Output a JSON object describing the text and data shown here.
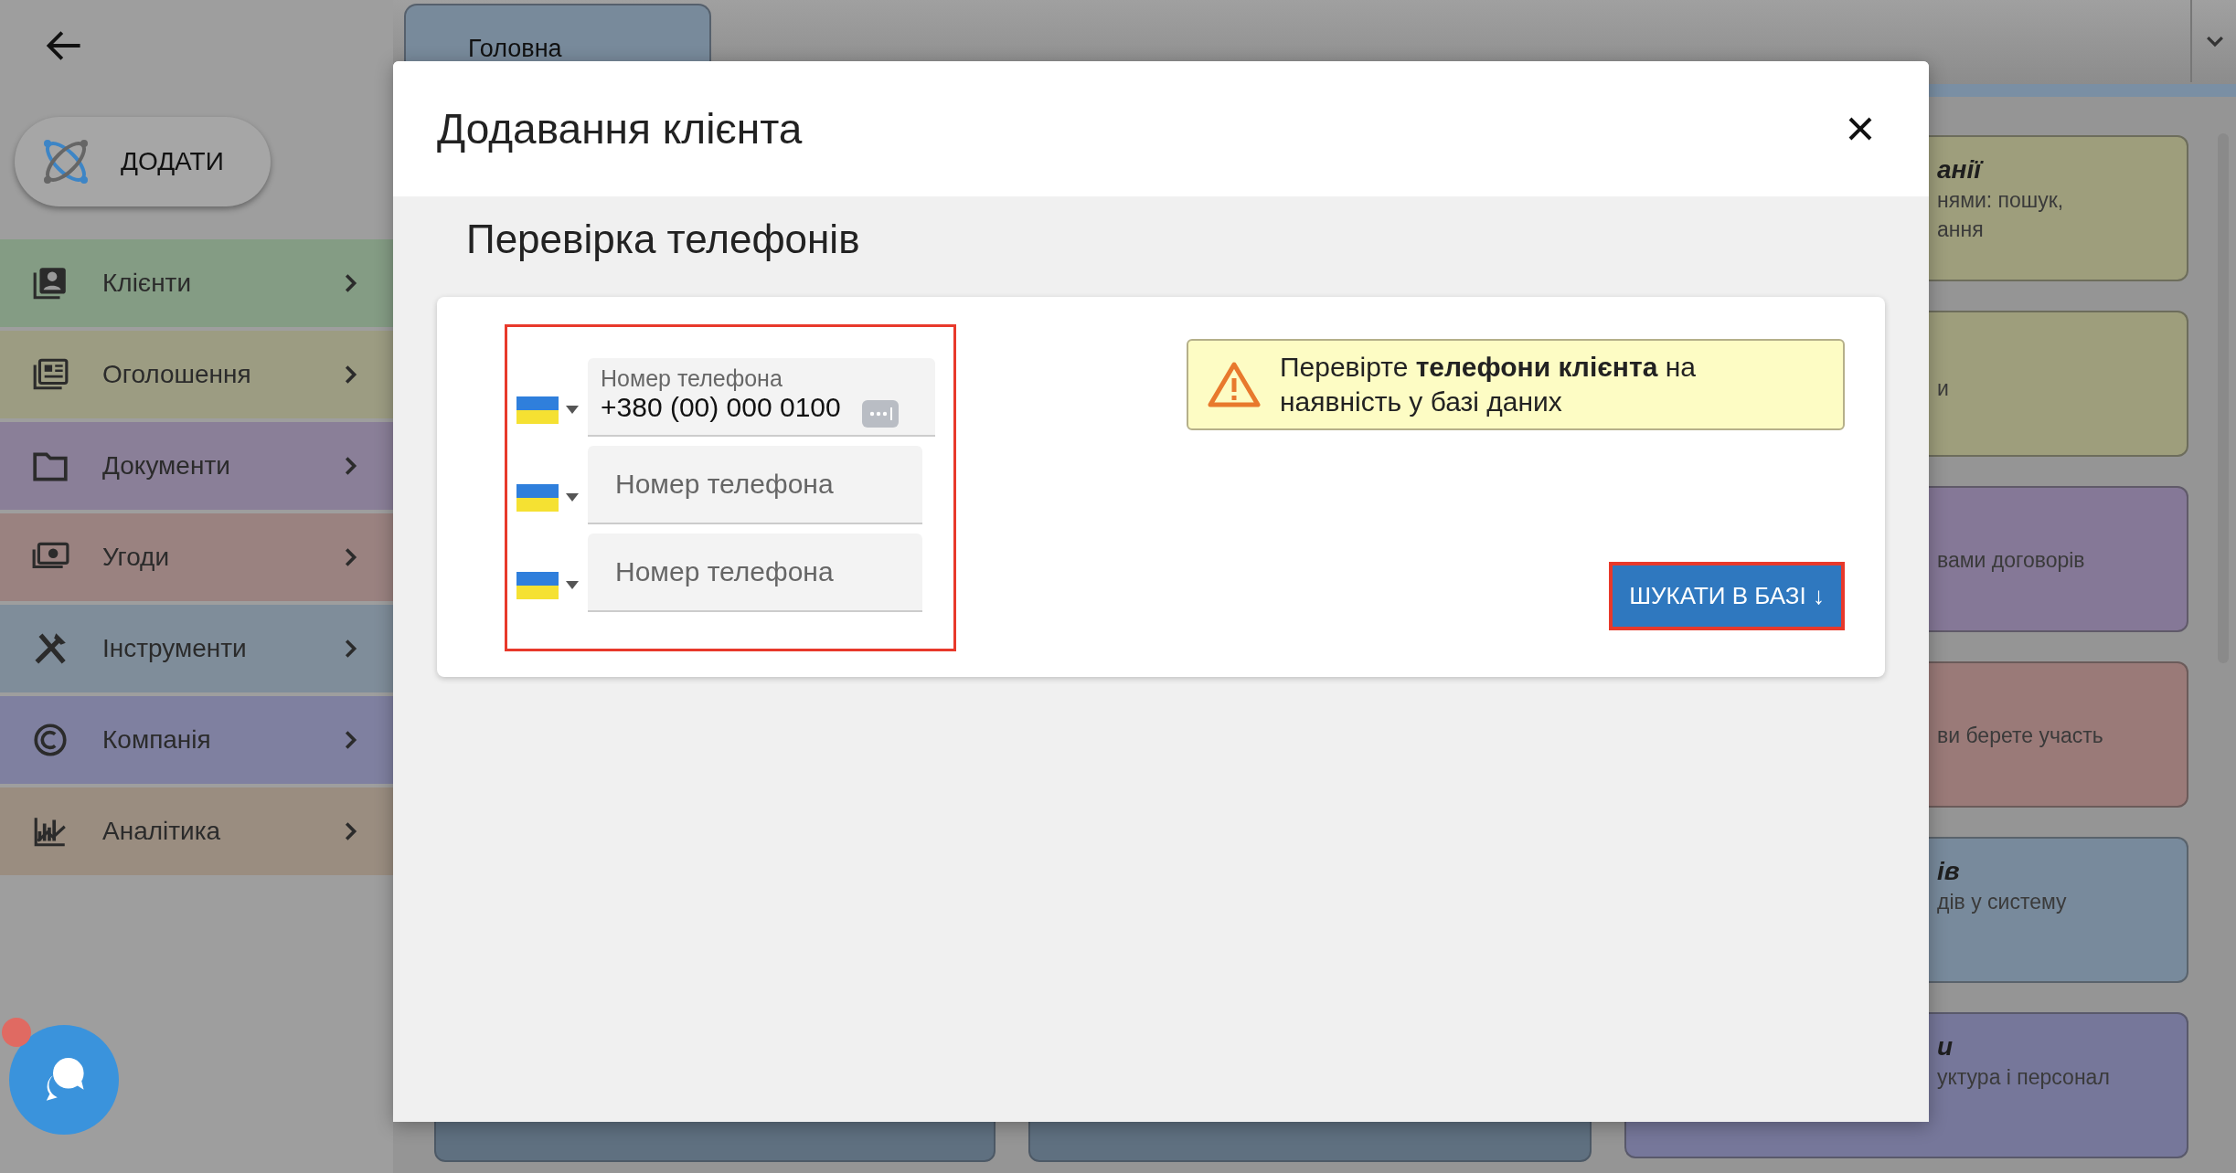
{
  "add_button": {
    "label": "ДОДАТИ"
  },
  "sidebar": {
    "items": [
      {
        "label": "Клієнти",
        "color": "#849c84"
      },
      {
        "label": "Оголошення",
        "color": "#9c9c82"
      },
      {
        "label": "Документи",
        "color": "#8a7f98"
      },
      {
        "label": "Угоди",
        "color": "#9a8280"
      },
      {
        "label": "Інструменти",
        "color": "#7f8d9a"
      },
      {
        "label": "Компанія",
        "color": "#7f80a0"
      },
      {
        "label": "Аналітика",
        "color": "#9a8d80"
      }
    ]
  },
  "tabs": [
    {
      "label": "Головна",
      "selected": true
    }
  ],
  "cards": [
    {
      "title": "анії",
      "lines": [
        "нями: пошук,",
        "ання"
      ],
      "color": "#9e9e7c"
    },
    {
      "lines": [
        "и"
      ],
      "color": "#9e9e7c"
    },
    {
      "lines": [
        "вами договорів"
      ],
      "color": "#857897"
    },
    {
      "lines": [
        "ви берете участь"
      ],
      "color": "#9a7a78"
    },
    {
      "title": "ів",
      "lines": [
        "дів у систему"
      ],
      "color": "#788a9c"
    },
    {
      "title": "и",
      "lines": [
        "уктура і персонал"
      ],
      "color": "#76779a"
    }
  ],
  "bottom_cards": [
    {
      "color": "#5f7080"
    },
    {
      "color": "#5f7080"
    }
  ],
  "dialog": {
    "title": "Додавання клієнта",
    "section_title": "Перевірка телефонів",
    "phones": [
      {
        "label": "Номер телефона",
        "value": "+380 (00) 000 0100"
      },
      {
        "placeholder": "Номер телефона"
      },
      {
        "placeholder": "Номер телефона"
      }
    ],
    "alert": {
      "text": "Перевірте **телефони клієнта** на наявність у базі даних"
    },
    "search_button": {
      "label": "ШУКАТИ В БАЗІ ↓"
    }
  }
}
